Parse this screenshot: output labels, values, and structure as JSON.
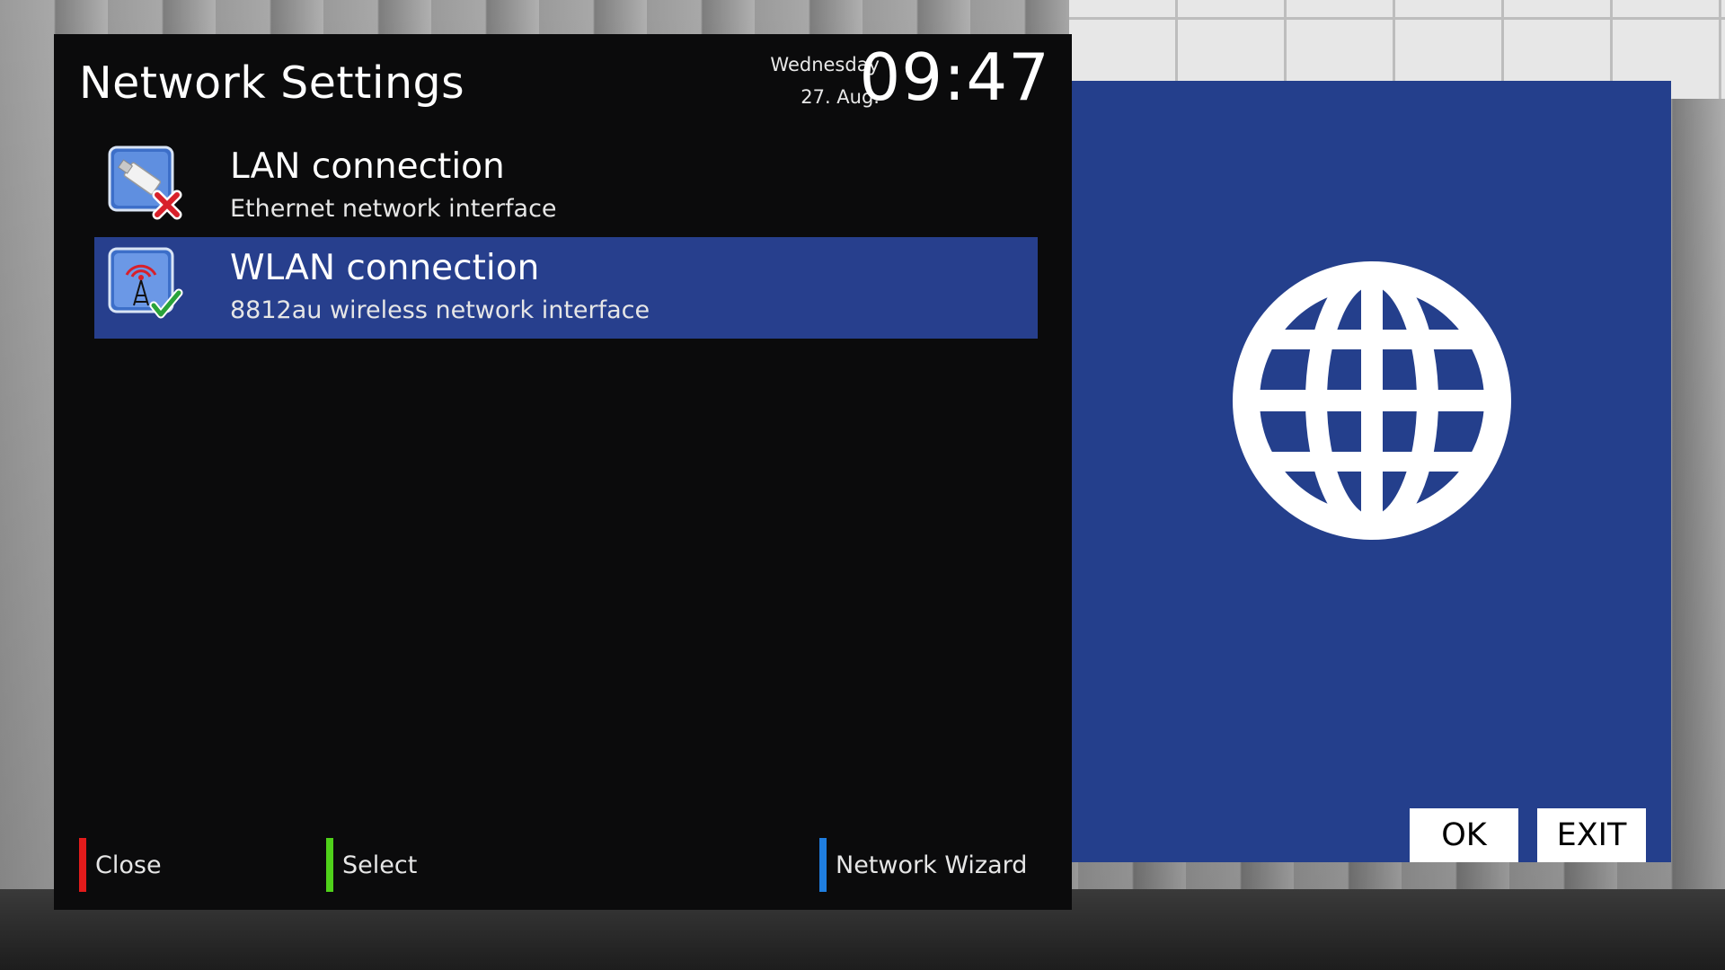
{
  "screen": {
    "title": "Network Settings",
    "date_day": "Wednesday",
    "date_date": "27. Aug.",
    "clock": "09:47"
  },
  "interfaces": [
    {
      "title": "LAN connection",
      "subtitle": "Ethernet network interface",
      "icon": "ethernet-disconnected-icon",
      "status": "disconnected",
      "selected": false
    },
    {
      "title": "WLAN connection",
      "subtitle": "8812au wireless network interface",
      "icon": "wireless-connected-icon",
      "status": "connected",
      "selected": true
    }
  ],
  "keys": {
    "red": "Close",
    "green": "Select",
    "blue": "Network Wizard"
  },
  "info_panel": {
    "icon": "globe-icon",
    "ok_label": "OK",
    "exit_label": "EXIT"
  },
  "colors": {
    "panel_bg": "#0b0b0c",
    "selection": "#273f8d",
    "info_bg": "#243f8c",
    "key_red": "#e31b1b",
    "key_green": "#4fd11a",
    "key_blue": "#1f7ee0"
  }
}
